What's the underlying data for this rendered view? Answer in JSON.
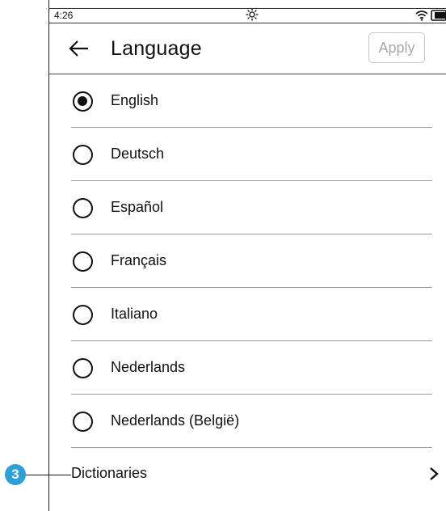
{
  "status_bar": {
    "time": "4:26",
    "icons": [
      "brightness-icon",
      "wifi-icon",
      "battery-icon"
    ]
  },
  "header": {
    "back_icon": "arrow-left-icon",
    "title": "Language",
    "apply_label": "Apply"
  },
  "languages": [
    {
      "label": "English",
      "selected": true
    },
    {
      "label": "Deutsch",
      "selected": false
    },
    {
      "label": "Español",
      "selected": false
    },
    {
      "label": "Français",
      "selected": false
    },
    {
      "label": "Italiano",
      "selected": false
    },
    {
      "label": "Nederlands",
      "selected": false
    },
    {
      "label": "Nederlands (België)",
      "selected": false
    }
  ],
  "dictionaries": {
    "label": "Dictionaries",
    "icon": "chevron-right-icon"
  },
  "callout": {
    "number": "3",
    "color": "#2f9fd8"
  },
  "colors": {
    "apply_disabled_text": "#a8a8a8",
    "divider": "#9a9a9a"
  }
}
